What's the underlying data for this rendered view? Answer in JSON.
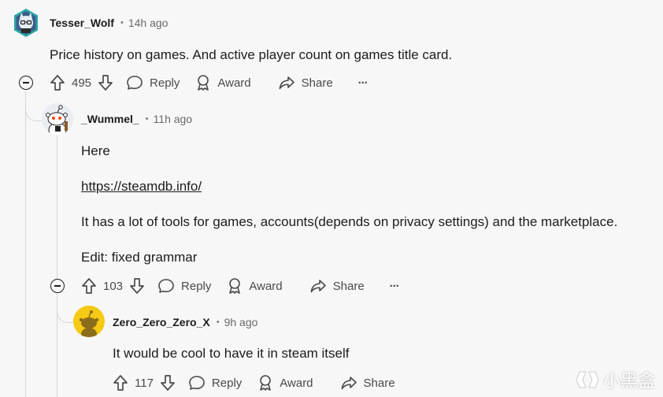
{
  "comments": [
    {
      "username": "Tesser_Wolf",
      "time": "14h ago",
      "body": [
        "Price history on games. And active player count on games title card."
      ],
      "votes": "495",
      "actions": {
        "reply": "Reply",
        "award": "Award",
        "share": "Share",
        "more": "···"
      }
    },
    {
      "username": "_Wummel_",
      "time": "11h ago",
      "body": [
        "Here",
        "https://steamdb.info/",
        "It has a lot of tools for games, accounts(depends on privacy settings) and the marketplace.",
        "Edit: fixed grammar"
      ],
      "votes": "103",
      "actions": {
        "reply": "Reply",
        "award": "Award",
        "share": "Share",
        "more": "···"
      }
    },
    {
      "username": "Zero_Zero_Zero_X",
      "time": "9h ago",
      "body": [
        "It would be cool to have it in steam itself"
      ],
      "votes": "117",
      "actions": {
        "reply": "Reply",
        "award": "Award",
        "share": "Share"
      }
    }
  ],
  "meta": {
    "separator": "•"
  },
  "watermark": {
    "text": "小黑盒"
  },
  "colors": {
    "text": "#1c1c1c",
    "muted": "#4a4a4a",
    "line": "#d5d5d5",
    "background": "#f7f7f7"
  }
}
